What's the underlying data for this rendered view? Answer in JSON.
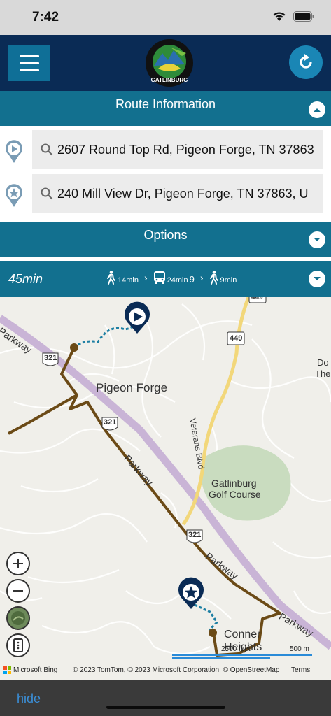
{
  "status": {
    "time": "7:42"
  },
  "header": {
    "menu_icon": "hamburger-icon",
    "logo_text": "GATLINBURG",
    "refresh_icon": "refresh-icon"
  },
  "route_info": {
    "title": "Route Information",
    "origin": "2607 Round Top Rd, Pigeon Forge, TN 37863",
    "destination": "240 Mill View Dr, Pigeon Forge, TN 37863, U"
  },
  "options": {
    "title": "Options"
  },
  "summary": {
    "duration": "45min",
    "walk1": "14min",
    "bus": "24min",
    "bus_route": "9",
    "walk2": "9min"
  },
  "map": {
    "place_pigeon_forge": "Pigeon Forge",
    "road_parkway_1": "Parkway",
    "road_parkway_2": "Parkway",
    "road_parkway_3": "Parkway",
    "road_veterans": "Veterans Blvd",
    "golf_line1": "Gatlinburg",
    "golf_line2": "Golf Course",
    "place_conner_1": "Conner",
    "place_conner_2": "Heights",
    "dollywood_1": "Do",
    "dollywood_2": "The",
    "shield_321_a": "321",
    "shield_321_b": "321",
    "shield_321_c": "321",
    "shield_449_a": "449",
    "shield_449_b": "449",
    "scale_feet": "2500 feet",
    "scale_m": "500 m",
    "provider": "Microsoft Bing",
    "attribution": "© 2023 TomTom, © 2023 Microsoft Corporation, © OpenStreetMap",
    "terms": "Terms"
  },
  "footer": {
    "hide": "hide"
  },
  "colors": {
    "header": "#0a2b55",
    "section": "#12708f",
    "route": "#6b4a16",
    "walk": "#1d7fa3"
  }
}
